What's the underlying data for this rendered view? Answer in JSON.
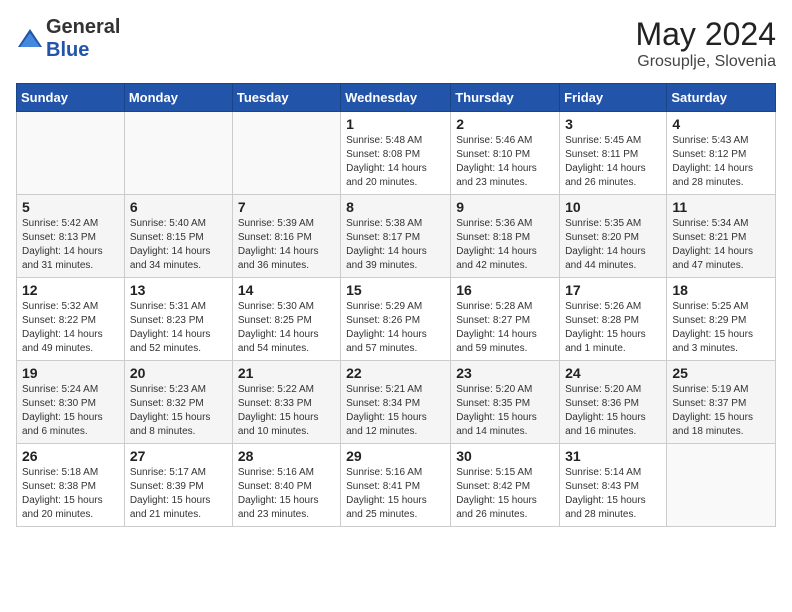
{
  "header": {
    "logo_general": "General",
    "logo_blue": "Blue",
    "title": "May 2024",
    "subtitle": "Grosuplje, Slovenia"
  },
  "days_of_week": [
    "Sunday",
    "Monday",
    "Tuesday",
    "Wednesday",
    "Thursday",
    "Friday",
    "Saturday"
  ],
  "weeks": [
    [
      {
        "day": "",
        "info": ""
      },
      {
        "day": "",
        "info": ""
      },
      {
        "day": "",
        "info": ""
      },
      {
        "day": "1",
        "info": "Sunrise: 5:48 AM\nSunset: 8:08 PM\nDaylight: 14 hours\nand 20 minutes."
      },
      {
        "day": "2",
        "info": "Sunrise: 5:46 AM\nSunset: 8:10 PM\nDaylight: 14 hours\nand 23 minutes."
      },
      {
        "day": "3",
        "info": "Sunrise: 5:45 AM\nSunset: 8:11 PM\nDaylight: 14 hours\nand 26 minutes."
      },
      {
        "day": "4",
        "info": "Sunrise: 5:43 AM\nSunset: 8:12 PM\nDaylight: 14 hours\nand 28 minutes."
      }
    ],
    [
      {
        "day": "5",
        "info": "Sunrise: 5:42 AM\nSunset: 8:13 PM\nDaylight: 14 hours\nand 31 minutes."
      },
      {
        "day": "6",
        "info": "Sunrise: 5:40 AM\nSunset: 8:15 PM\nDaylight: 14 hours\nand 34 minutes."
      },
      {
        "day": "7",
        "info": "Sunrise: 5:39 AM\nSunset: 8:16 PM\nDaylight: 14 hours\nand 36 minutes."
      },
      {
        "day": "8",
        "info": "Sunrise: 5:38 AM\nSunset: 8:17 PM\nDaylight: 14 hours\nand 39 minutes."
      },
      {
        "day": "9",
        "info": "Sunrise: 5:36 AM\nSunset: 8:18 PM\nDaylight: 14 hours\nand 42 minutes."
      },
      {
        "day": "10",
        "info": "Sunrise: 5:35 AM\nSunset: 8:20 PM\nDaylight: 14 hours\nand 44 minutes."
      },
      {
        "day": "11",
        "info": "Sunrise: 5:34 AM\nSunset: 8:21 PM\nDaylight: 14 hours\nand 47 minutes."
      }
    ],
    [
      {
        "day": "12",
        "info": "Sunrise: 5:32 AM\nSunset: 8:22 PM\nDaylight: 14 hours\nand 49 minutes."
      },
      {
        "day": "13",
        "info": "Sunrise: 5:31 AM\nSunset: 8:23 PM\nDaylight: 14 hours\nand 52 minutes."
      },
      {
        "day": "14",
        "info": "Sunrise: 5:30 AM\nSunset: 8:25 PM\nDaylight: 14 hours\nand 54 minutes."
      },
      {
        "day": "15",
        "info": "Sunrise: 5:29 AM\nSunset: 8:26 PM\nDaylight: 14 hours\nand 57 minutes."
      },
      {
        "day": "16",
        "info": "Sunrise: 5:28 AM\nSunset: 8:27 PM\nDaylight: 14 hours\nand 59 minutes."
      },
      {
        "day": "17",
        "info": "Sunrise: 5:26 AM\nSunset: 8:28 PM\nDaylight: 15 hours\nand 1 minute."
      },
      {
        "day": "18",
        "info": "Sunrise: 5:25 AM\nSunset: 8:29 PM\nDaylight: 15 hours\nand 3 minutes."
      }
    ],
    [
      {
        "day": "19",
        "info": "Sunrise: 5:24 AM\nSunset: 8:30 PM\nDaylight: 15 hours\nand 6 minutes."
      },
      {
        "day": "20",
        "info": "Sunrise: 5:23 AM\nSunset: 8:32 PM\nDaylight: 15 hours\nand 8 minutes."
      },
      {
        "day": "21",
        "info": "Sunrise: 5:22 AM\nSunset: 8:33 PM\nDaylight: 15 hours\nand 10 minutes."
      },
      {
        "day": "22",
        "info": "Sunrise: 5:21 AM\nSunset: 8:34 PM\nDaylight: 15 hours\nand 12 minutes."
      },
      {
        "day": "23",
        "info": "Sunrise: 5:20 AM\nSunset: 8:35 PM\nDaylight: 15 hours\nand 14 minutes."
      },
      {
        "day": "24",
        "info": "Sunrise: 5:20 AM\nSunset: 8:36 PM\nDaylight: 15 hours\nand 16 minutes."
      },
      {
        "day": "25",
        "info": "Sunrise: 5:19 AM\nSunset: 8:37 PM\nDaylight: 15 hours\nand 18 minutes."
      }
    ],
    [
      {
        "day": "26",
        "info": "Sunrise: 5:18 AM\nSunset: 8:38 PM\nDaylight: 15 hours\nand 20 minutes."
      },
      {
        "day": "27",
        "info": "Sunrise: 5:17 AM\nSunset: 8:39 PM\nDaylight: 15 hours\nand 21 minutes."
      },
      {
        "day": "28",
        "info": "Sunrise: 5:16 AM\nSunset: 8:40 PM\nDaylight: 15 hours\nand 23 minutes."
      },
      {
        "day": "29",
        "info": "Sunrise: 5:16 AM\nSunset: 8:41 PM\nDaylight: 15 hours\nand 25 minutes."
      },
      {
        "day": "30",
        "info": "Sunrise: 5:15 AM\nSunset: 8:42 PM\nDaylight: 15 hours\nand 26 minutes."
      },
      {
        "day": "31",
        "info": "Sunrise: 5:14 AM\nSunset: 8:43 PM\nDaylight: 15 hours\nand 28 minutes."
      },
      {
        "day": "",
        "info": ""
      }
    ]
  ]
}
